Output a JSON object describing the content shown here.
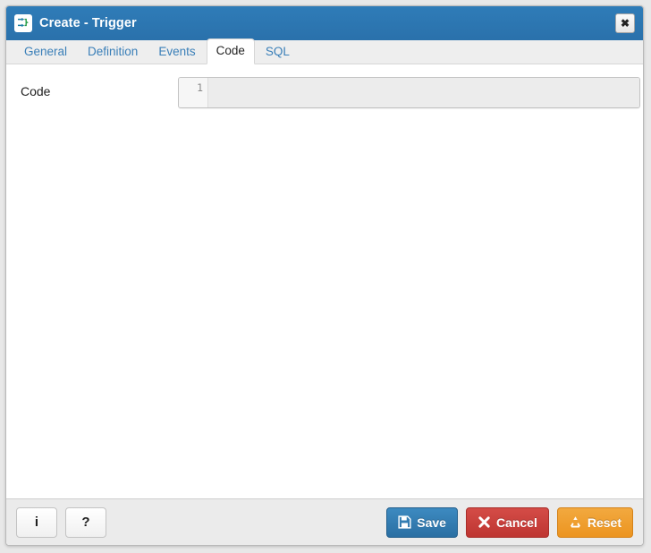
{
  "window": {
    "title": "Create - Trigger",
    "icon": "trigger-icon",
    "close_label": "✖",
    "titlebar_color": "#2a74b0"
  },
  "tabs": [
    {
      "label": "General",
      "active": false
    },
    {
      "label": "Definition",
      "active": false
    },
    {
      "label": "Events",
      "active": false
    },
    {
      "label": "Code",
      "active": true
    },
    {
      "label": "SQL",
      "active": false
    }
  ],
  "form": {
    "code_label": "Code",
    "code_editor": {
      "line_number": "1",
      "value": "",
      "placeholder": ""
    }
  },
  "footer": {
    "info_label": "i",
    "help_label": "?",
    "save_label": "Save",
    "cancel_label": "Cancel",
    "reset_label": "Reset",
    "save_color": "#2a6fa3",
    "cancel_color": "#be3531",
    "reset_color": "#ec9420"
  }
}
